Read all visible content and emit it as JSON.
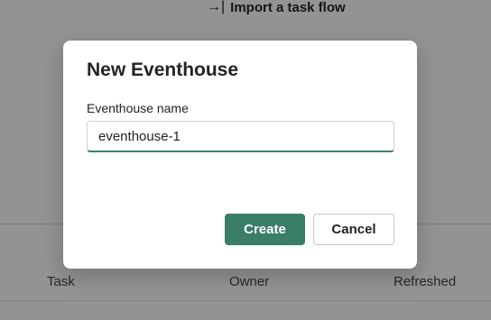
{
  "background": {
    "import_link": {
      "icon": "import-arrow-icon",
      "label": "Import a task flow"
    },
    "table_headers": [
      "Task",
      "Owner",
      "Refreshed"
    ]
  },
  "dialog": {
    "title": "New Eventhouse",
    "field_label": "Eventhouse name",
    "input_value": "eventhouse-1",
    "create_label": "Create",
    "cancel_label": "Cancel"
  },
  "colors": {
    "primary": "#3a7d68",
    "input_underline": "#3f7f6c",
    "overlay": "rgba(0,0,0,0.4)"
  }
}
